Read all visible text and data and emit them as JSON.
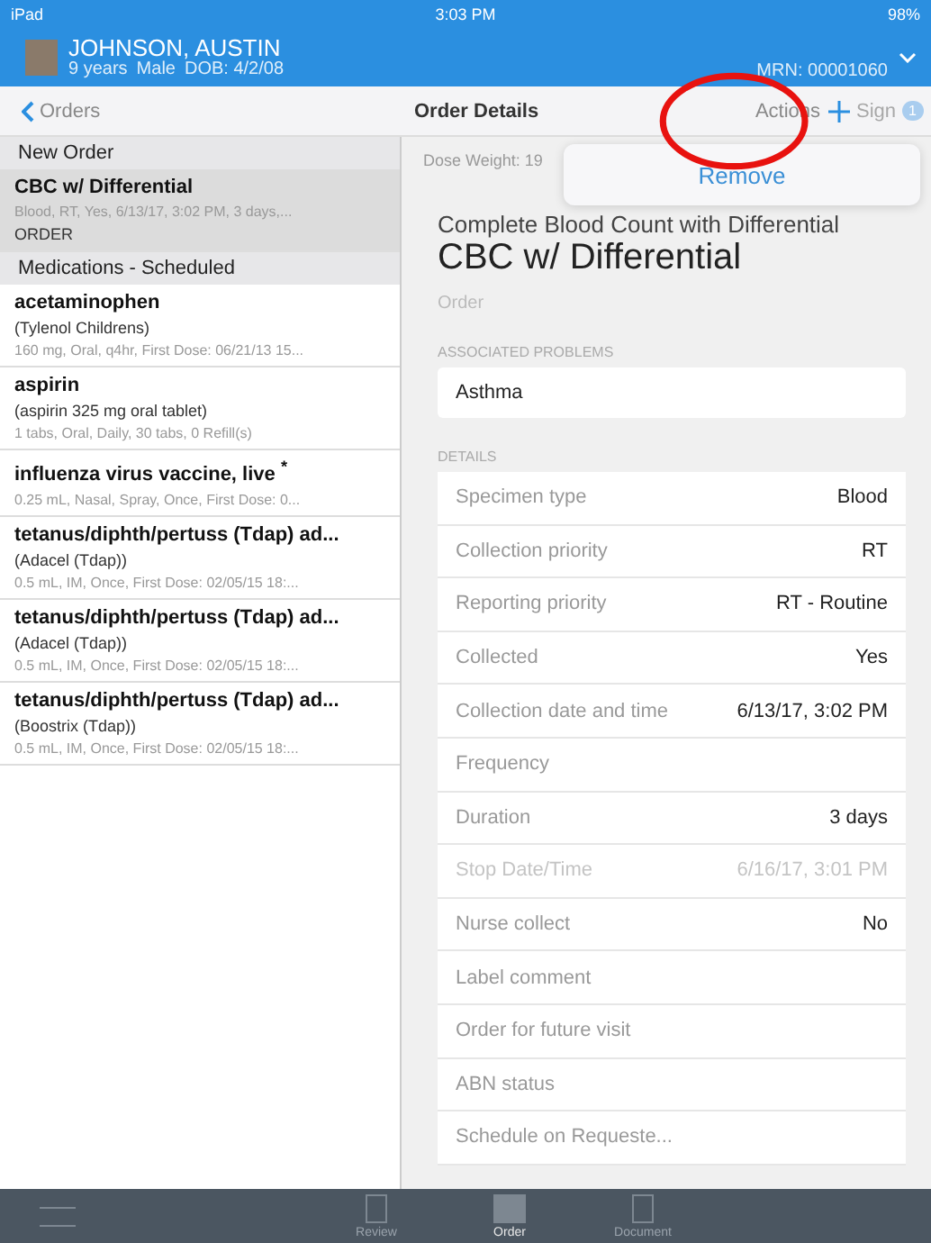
{
  "status_bar": {
    "device": "iPad",
    "time": "3:03 PM",
    "battery": "98%"
  },
  "patient": {
    "name": "JOHNSON, AUSTIN",
    "age": "9 years",
    "sex": "Male",
    "dob": "DOB: 4/2/08",
    "mrn": "MRN: 00001060"
  },
  "nav": {
    "back": "Orders",
    "title": "Order Details",
    "actions": "Actions",
    "sign": {
      "label": "Sign",
      "badge": "1",
      "disabled": true
    }
  },
  "popover": {
    "items": [
      "Remove"
    ]
  },
  "order_list": [
    {
      "kind": "section",
      "title": "New Order"
    },
    {
      "kind": "item",
      "title": "CBC w/ Differential",
      "details": "Blood, RT, Yes, 6/13/17, 3:02 PM, 3 days,...",
      "tag": "ORDER",
      "selected": true
    },
    {
      "kind": "section",
      "title": "Medications - Scheduled"
    },
    {
      "kind": "item",
      "title": "acetaminophen",
      "subtitle": "(Tylenol Childrens)",
      "details": "160 mg, Oral, q4hr, First Dose: 06/21/13 15...",
      "selected": false
    },
    {
      "kind": "item",
      "title": "aspirin",
      "subtitle": "(aspirin 325 mg oral tablet)",
      "details": "1 tabs, Oral, Daily, 30 tabs, 0 Refill(s)",
      "selected": false
    },
    {
      "kind": "item",
      "title": "influenza virus vaccine, live $^{*}$",
      "details": "0.25 mL, Nasal, Spray, Once, First Dose: 0...",
      "selected": false
    },
    {
      "kind": "item",
      "title": "tetanus/diphth/pertuss (Tdap) ad...",
      "subtitle": "(Adacel (Tdap))",
      "details": "0.5 mL, IM, Once, First Dose: 02/05/15 18:...",
      "selected": false
    },
    {
      "kind": "item",
      "title": "tetanus/diphth/pertuss (Tdap) ad...",
      "subtitle": "(Adacel (Tdap))",
      "details": "0.5 mL, IM, Once, First Dose: 02/05/15 18:...",
      "selected": false
    },
    {
      "kind": "item",
      "title": "tetanus/diphth/pertuss (Tdap) ad...",
      "subtitle": "(Boostrix (Tdap))",
      "details": "0.5 mL, IM, Once, First Dose: 02/05/15 18:...",
      "selected": false
    }
  ],
  "detail": {
    "dose_weight": "Dose Weight: 19",
    "full_name": "Complete Blood Count with Differential",
    "name": "CBC w/ Differential",
    "type": "Order",
    "problems_label": "ASSOCIATED PROBLEMS",
    "problems": [
      "Asthma"
    ],
    "details_label": "DETAILS",
    "rows": [
      {
        "label": "Specimen type",
        "value": "Blood",
        "disabled": false
      },
      {
        "label": "Collection priority",
        "value": "RT",
        "disabled": false
      },
      {
        "label": "Reporting priority",
        "value": "RT - Routine",
        "disabled": false
      },
      {
        "label": "Collected",
        "value": "Yes",
        "disabled": false
      },
      {
        "label": "Collection date and time",
        "value": "6/13/17, 3:02 PM",
        "disabled": false
      },
      {
        "label": "Frequency",
        "disabled": false
      },
      {
        "label": "Duration",
        "value": "3 days",
        "disabled": false
      },
      {
        "label": "Stop Date/Time",
        "value": "6/16/17, 3:01 PM",
        "disabled": true
      },
      {
        "label": "Nurse collect",
        "value": "No",
        "disabled": false
      },
      {
        "label": "Label comment",
        "disabled": false
      },
      {
        "label": "Order for future visit",
        "disabled": false
      },
      {
        "label": "ABN status",
        "disabled": false
      },
      {
        "label": "Schedule on Requeste...",
        "disabled": false
      }
    ]
  },
  "tab_bar": [
    {
      "label": "Review",
      "selected": false
    },
    {
      "label": "Order",
      "selected": true
    },
    {
      "label": "Document",
      "selected": false
    }
  ]
}
